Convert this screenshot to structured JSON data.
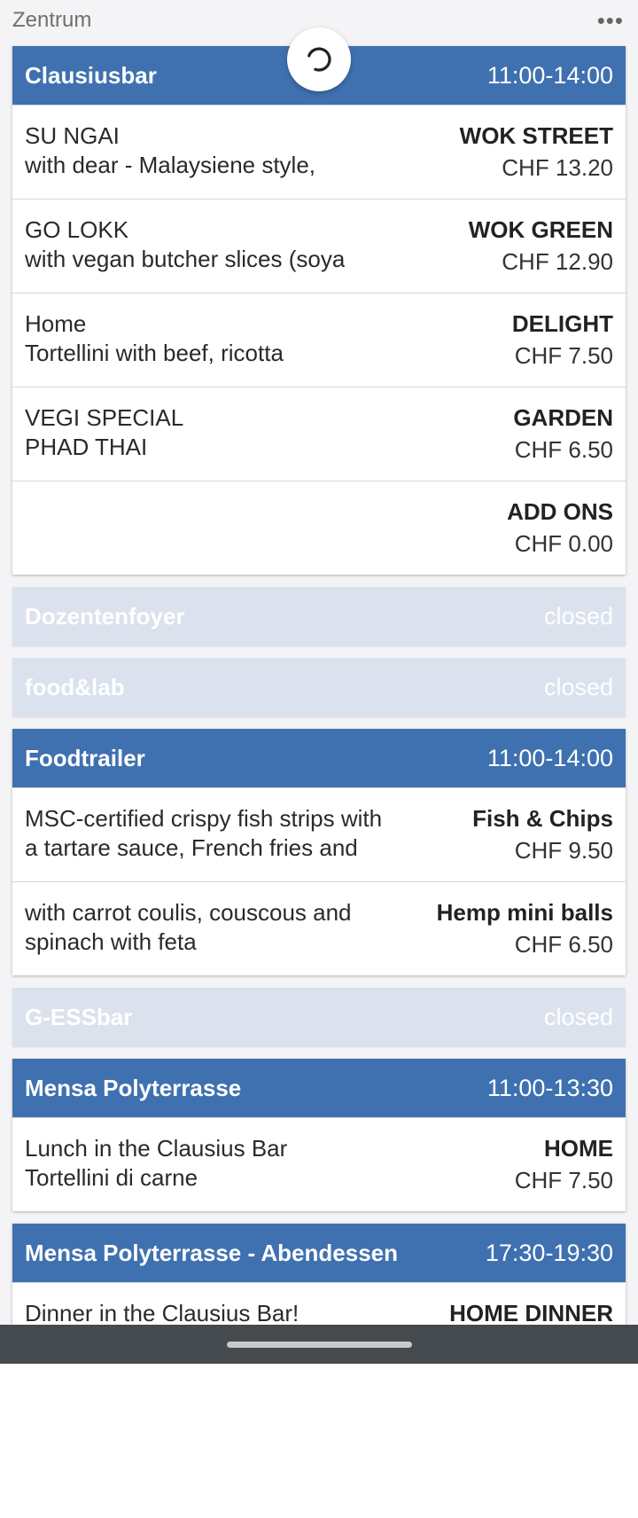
{
  "header": {
    "title": "Zentrum",
    "more_icon": "more-horizontal-icon"
  },
  "mensas": [
    {
      "name": "Clausiusbar",
      "hours": "11:00-14:00",
      "items": [
        {
          "line1": "SU NGAI",
          "line2": "with dear - Malaysiene style,",
          "name": "WOK STREET",
          "price": "CHF 13.20"
        },
        {
          "line1": "GO LOKK",
          "line2": "with vegan butcher slices (soya",
          "name": "WOK GREEN",
          "price": "CHF 12.90"
        },
        {
          "line1": "Home",
          "line2": "Tortellini with beef, ricotta",
          "name": "DELIGHT",
          "price": "CHF 7.50"
        },
        {
          "line1": "VEGI SPECIAL",
          "line2": "PHAD THAI",
          "name": "GARDEN",
          "price": "CHF 6.50"
        },
        {
          "line1": "",
          "line2": "",
          "name": "ADD ONS",
          "price": "CHF 0.00"
        }
      ]
    },
    {
      "name": "Dozentenfoyer",
      "hours": "closed"
    },
    {
      "name": "food&lab",
      "hours": "closed"
    },
    {
      "name": "Foodtrailer",
      "hours": "11:00-14:00",
      "items": [
        {
          "line1": "MSC-certified crispy fish strips with",
          "line2": "a tartare sauce, French fries and",
          "name": "Fish & Chips",
          "price": "CHF 9.50"
        },
        {
          "line1": "with carrot coulis, couscous and",
          "line2": "spinach with feta",
          "name": "Hemp mini balls",
          "price": "CHF 6.50"
        }
      ]
    },
    {
      "name": "G-ESSbar",
      "hours": "closed"
    },
    {
      "name": "Mensa Polyterrasse",
      "hours": "11:00-13:30",
      "items": [
        {
          "line1": "Lunch in the Clausius Bar",
          "line2": "Tortellini di carne",
          "name": "HOME",
          "price": "CHF 7.50"
        }
      ]
    },
    {
      "name": "Mensa Polyterrasse - Abendessen",
      "hours": "17:30-19:30",
      "items": [
        {
          "line1": "Dinner in the Clausius Bar!",
          "line2": "",
          "name": "HOME DINNER",
          "price": ""
        }
      ]
    }
  ],
  "colors": {
    "header_blue": "#3f71b0",
    "closed_bg": "#dbe2ee",
    "nav_bar": "#454a4e"
  }
}
